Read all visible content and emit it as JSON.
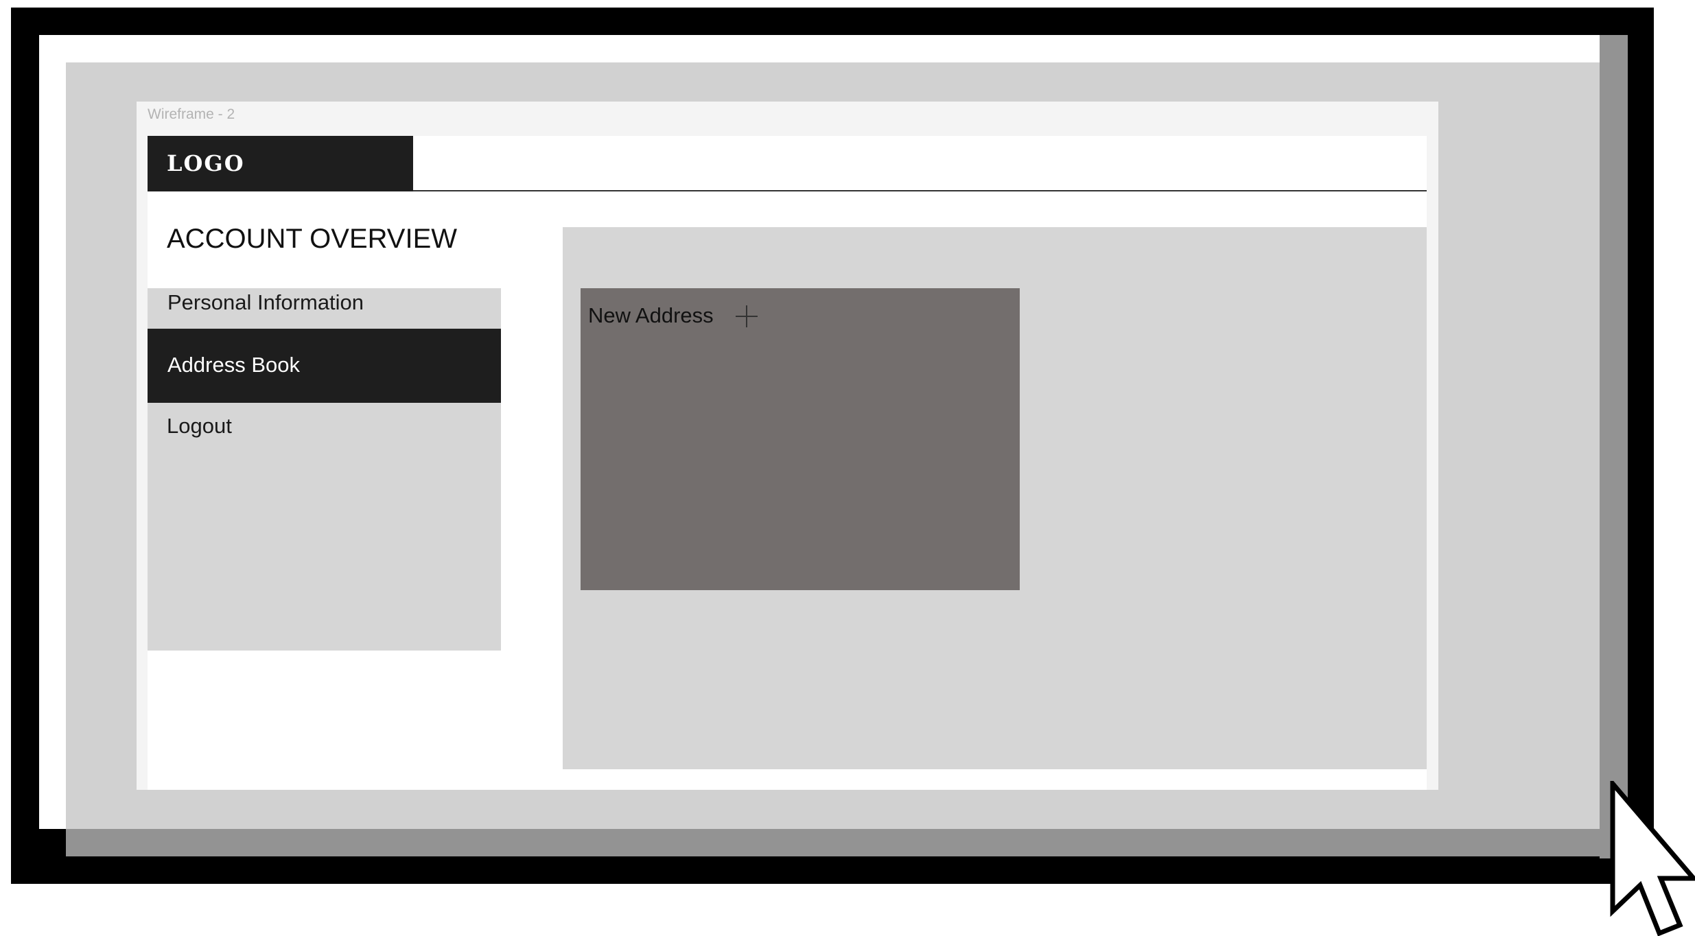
{
  "canvas": {
    "frame_label": "Wireframe - 2"
  },
  "header": {
    "logo": "LOGO"
  },
  "sidebar": {
    "title": "ACCOUNT OVERVIEW",
    "items": [
      {
        "label": "Personal Information",
        "active": false
      },
      {
        "label": "Address Book",
        "active": true
      },
      {
        "label": "Logout",
        "active": false
      }
    ]
  },
  "main": {
    "new_address_label": "New Address",
    "add_icon": "plus-icon"
  },
  "colors": {
    "dark": "#1e1e1e",
    "panel": "#d6d6d6",
    "card": "#736e6d",
    "canvas": "#d1d1d1",
    "frame": "#000000"
  },
  "cursor": {
    "icon": "arrow-cursor-icon"
  }
}
